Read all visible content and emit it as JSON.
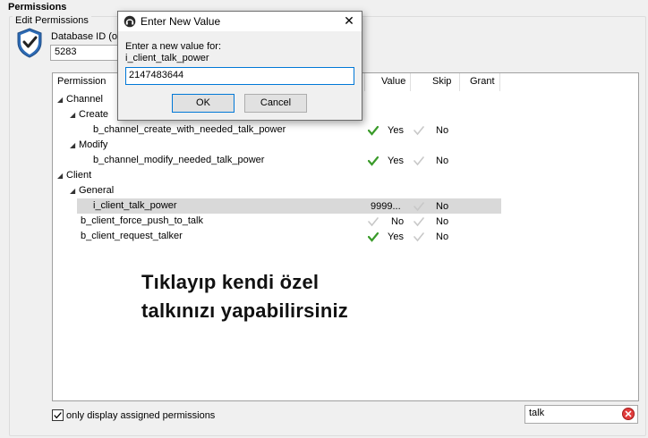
{
  "header": {
    "title": "Permissions",
    "group_label": "Edit Permissions"
  },
  "db": {
    "label": "Database ID (or",
    "value": "5283"
  },
  "columns": {
    "permission": "Permission",
    "value": "Value",
    "skip": "Skip",
    "grant": "Grant"
  },
  "tree": {
    "channel": "Channel",
    "create": "Create",
    "create_perm": "b_channel_create_with_needed_talk_power",
    "modify": "Modify",
    "modify_perm": "b_channel_modify_needed_talk_power",
    "client": "Client",
    "general": "General",
    "talk_power": "i_client_talk_power",
    "force_push": "b_client_force_push_to_talk",
    "request_talker": "b_client_request_talker"
  },
  "rows": {
    "create_perm": {
      "value": "Yes",
      "skip": "No"
    },
    "modify_perm": {
      "value": "Yes",
      "skip": "No"
    },
    "talk_power": {
      "value": "9999...",
      "skip": "No"
    },
    "force_push": {
      "value": "No",
      "skip": "No"
    },
    "request_talker": {
      "value": "Yes",
      "skip": "No"
    }
  },
  "overlay": {
    "line1": "Tıklayıp kendi özel",
    "line2": "talkınızı yapabilirsiniz"
  },
  "footer": {
    "only_assigned_label": "only display assigned permissions",
    "search_value": "talk"
  },
  "dialog": {
    "title": "Enter New Value",
    "close_glyph": "✕",
    "prompt_line1": "Enter a new value for:",
    "prompt_line2": "i_client_talk_power",
    "input_value": "2147483644",
    "ok_label": "OK",
    "cancel_label": "Cancel"
  },
  "colors": {
    "check_green": "#3a9b2a",
    "check_gray": "#c8c8c8",
    "clear_red": "#e23c3c"
  }
}
